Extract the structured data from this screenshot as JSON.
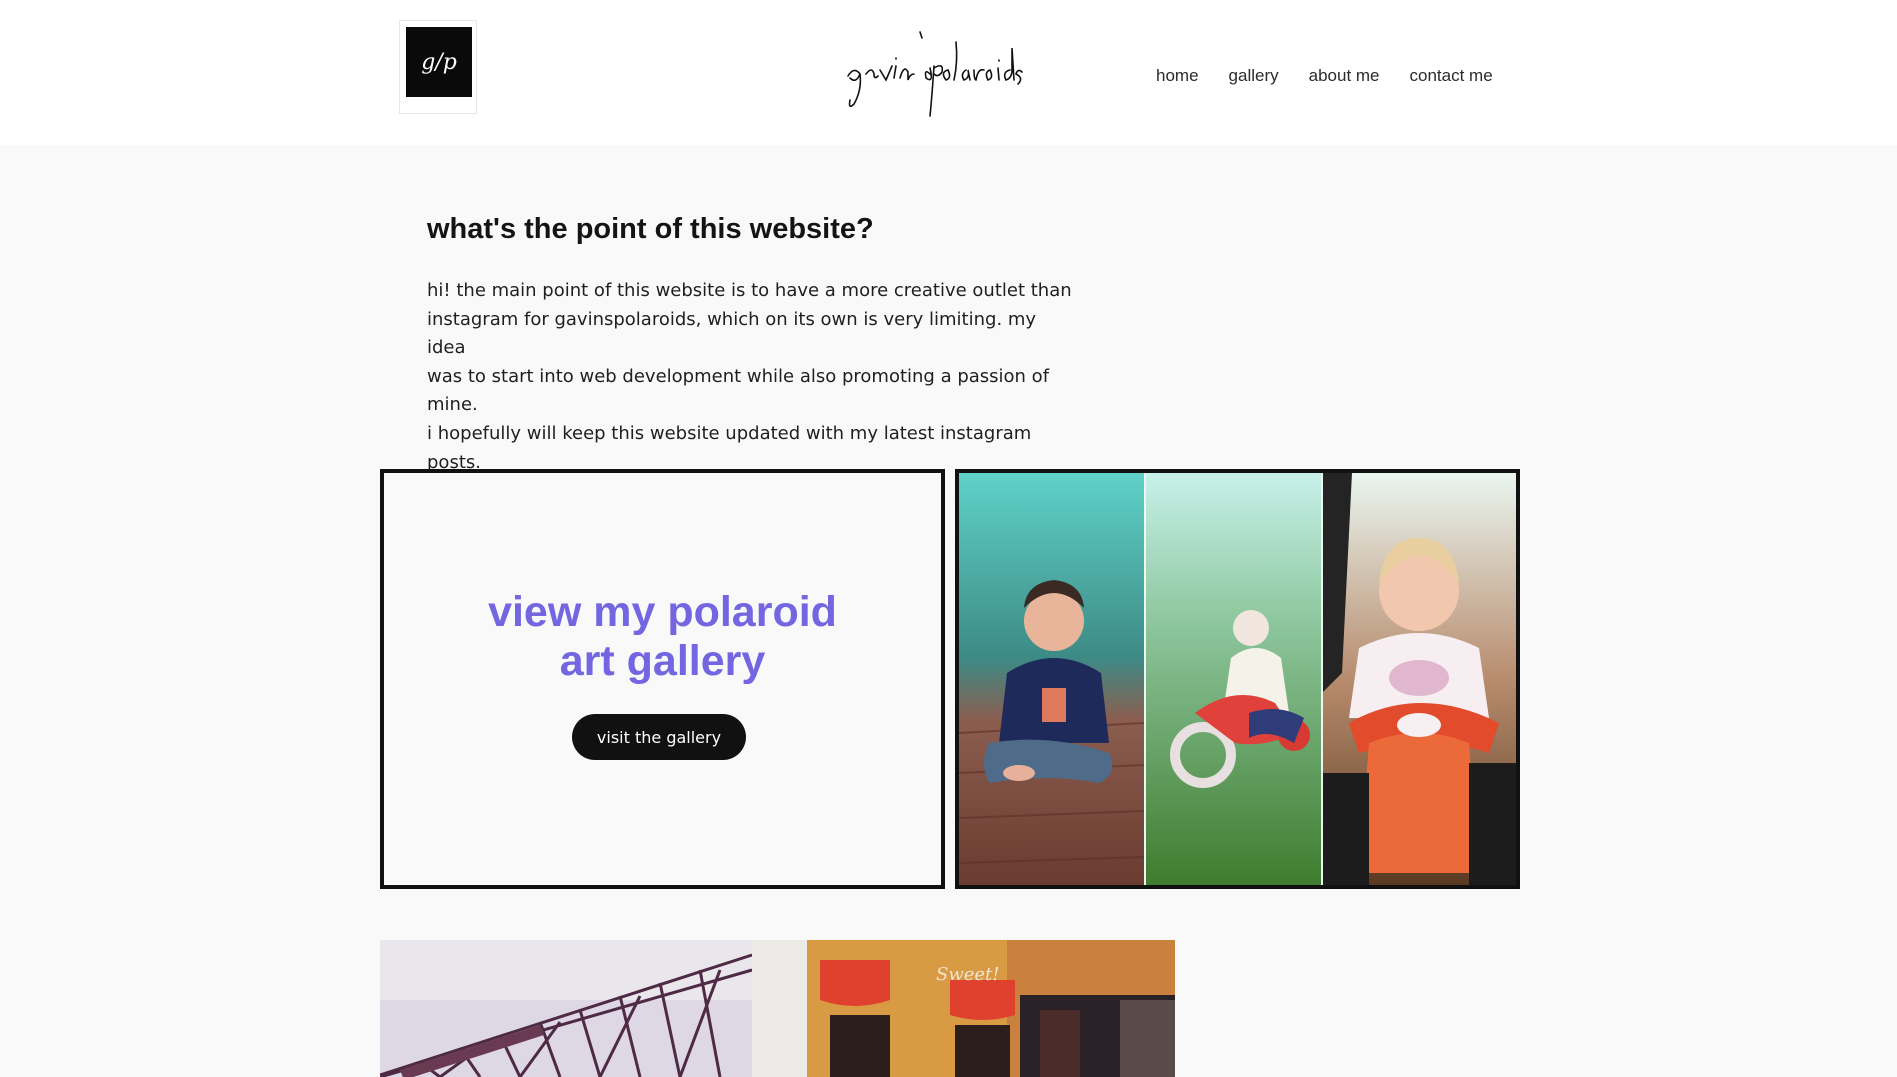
{
  "header": {
    "logo_text": "g/p",
    "brand_text": "gavin spolaroids",
    "nav": [
      "home",
      "gallery",
      "about me",
      "contact me"
    ]
  },
  "intro": {
    "title": "what's the point of this website?",
    "lines": [
      "hi! the main point of this website is to have a more creative outlet than",
      "instagram for gavinspolaroids, which on its own is very limiting. my idea",
      "was to start into web development while also promoting a passion of mine.",
      "i hopefully will keep this website updated with my latest instagram posts."
    ]
  },
  "gallery_card": {
    "heading_line1": "view my polaroid",
    "heading_line2": "art gallery",
    "button_label": "visit the gallery",
    "accent_color": "#7366e0"
  },
  "bottom_photo": {
    "sign_text": "Sweet!"
  }
}
